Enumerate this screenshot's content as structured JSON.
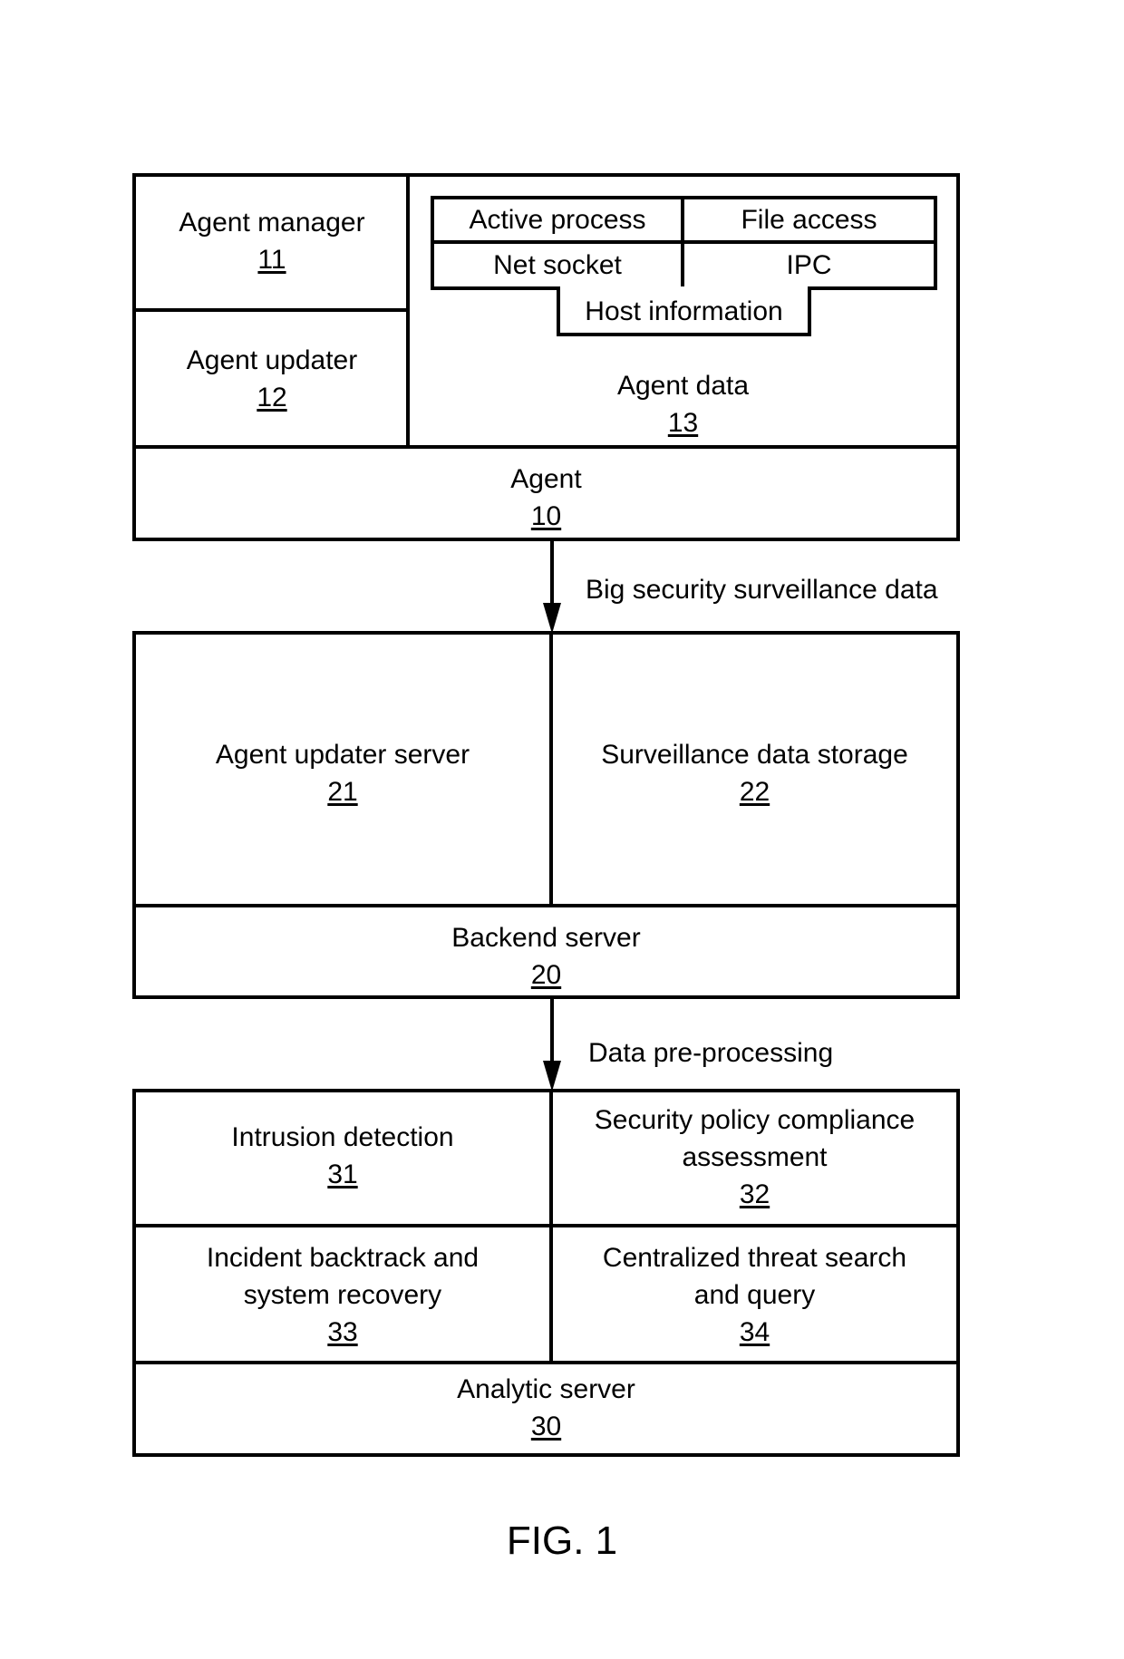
{
  "figure_label": "FIG. 1",
  "agent": {
    "title": "Agent",
    "ref": "10",
    "manager": {
      "title": "Agent manager",
      "ref": "11"
    },
    "updater": {
      "title": "Agent updater",
      "ref": "12"
    },
    "data": {
      "title": "Agent data",
      "ref": "13",
      "items": [
        "Active process",
        "File access",
        "Net socket",
        "IPC",
        "Host information"
      ]
    }
  },
  "arrow1_label": "Big security surveillance data",
  "backend": {
    "title": "Backend server",
    "ref": "20",
    "updater_server": {
      "title": "Agent updater server",
      "ref": "21"
    },
    "storage": {
      "title": "Surveillance data storage",
      "ref": "22"
    }
  },
  "arrow2_label": "Data pre-processing",
  "analytic": {
    "title": "Analytic server",
    "ref": "30",
    "intrusion": {
      "title": "Intrusion detection",
      "ref": "31"
    },
    "compliance": {
      "title_line1": "Security policy compliance",
      "title_line2": "assessment",
      "ref": "32"
    },
    "backtrack": {
      "title_line1": "Incident backtrack and",
      "title_line2": "system recovery",
      "ref": "33"
    },
    "search": {
      "title_line1": "Centralized threat search",
      "title_line2": "and query",
      "ref": "34"
    }
  }
}
